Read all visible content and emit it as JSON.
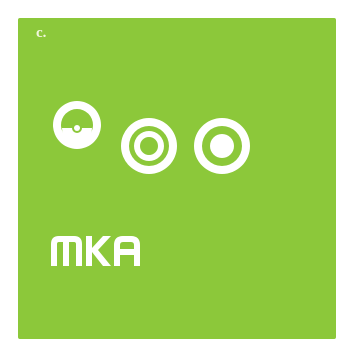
{
  "panel": {
    "label": "c.",
    "label_color": "#f1f6dc",
    "background_color": "#8cc83a"
  },
  "logo": {
    "symbol_color": "#ffffff",
    "symbols": [
      "half-circle-symbol",
      "concentric-rings-symbol",
      "dot-ring-symbol"
    ],
    "wordmark": "MKA"
  }
}
